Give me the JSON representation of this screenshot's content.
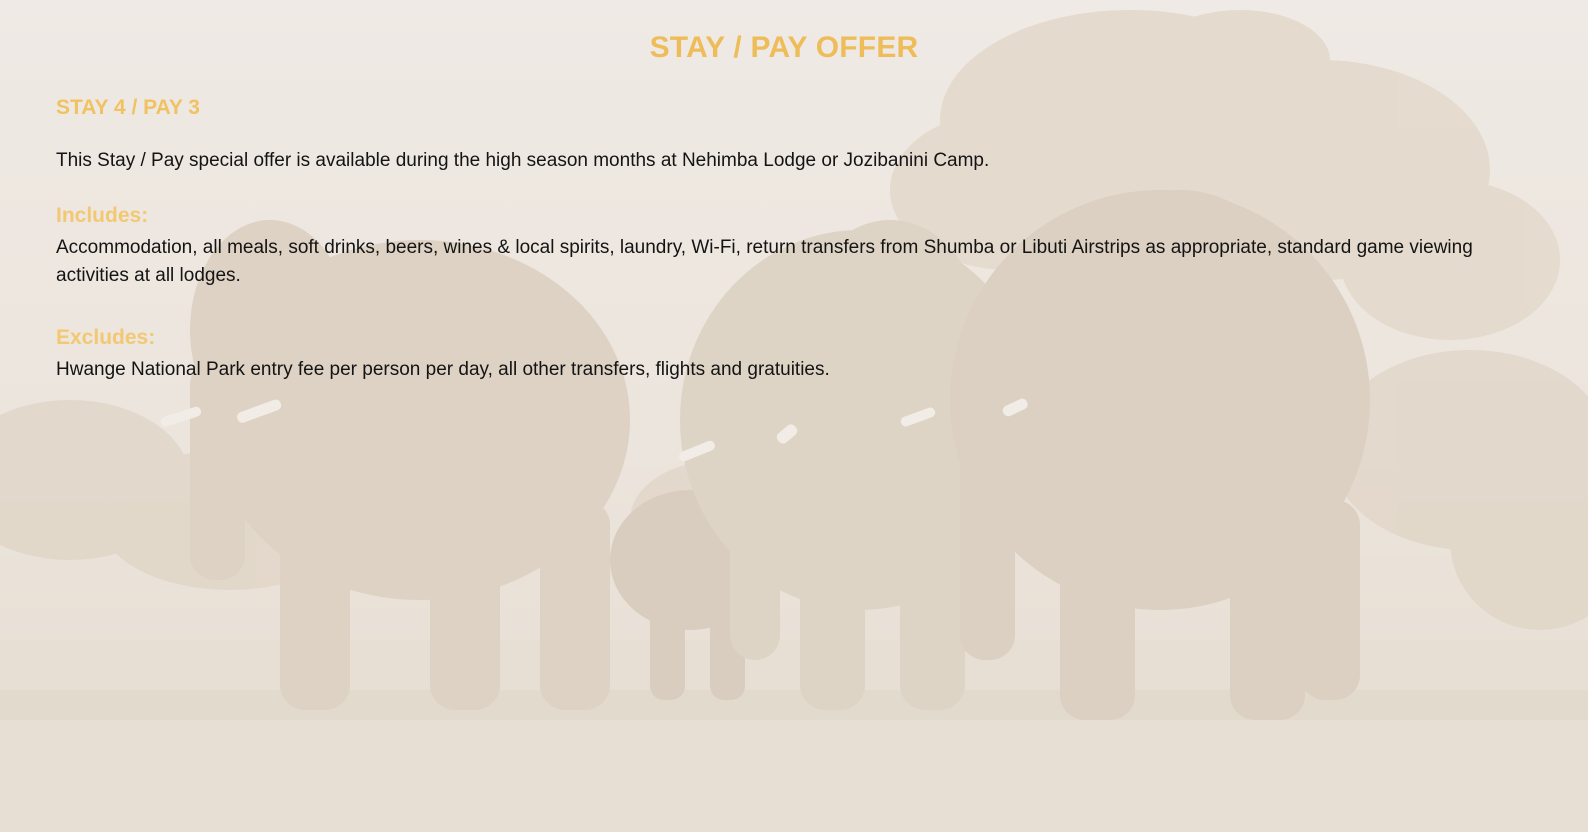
{
  "title": "STAY / PAY OFFER",
  "offer_heading": "STAY 4 / PAY 3",
  "intro": "This Stay / Pay special offer is available during the high season months at Nehimba Lodge or Jozibanini Camp.",
  "includes": {
    "label": "Includes:",
    "text": "Accommodation, all meals, soft drinks, beers, wines & local spirits, laundry, Wi-Fi, return transfers from Shumba or Libuti Airstrips as appropriate, standard game viewing activities at all lodges."
  },
  "excludes": {
    "label": "Excludes:",
    "text": "Hwange National Park entry fee per person per day, all other transfers, flights and gratuities."
  },
  "colors": {
    "accent": "#eebd5a",
    "background": "#ede6df",
    "text": "#141414"
  }
}
